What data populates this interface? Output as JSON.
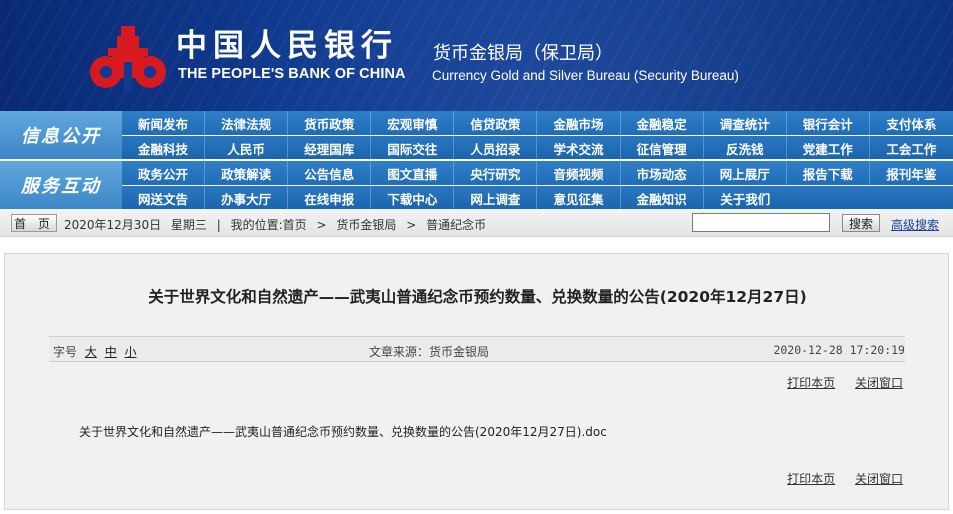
{
  "header": {
    "bank_name_cn": "中国人民银行",
    "bank_name_en": "THE PEOPLE'S BANK OF CHINA",
    "bureau_cn": "货币金银局（保卫局）",
    "bureau_en": "Currency  Gold and Silver Bureau (Security Bureau)",
    "logo": "pboc-logo-icon",
    "colors": {
      "banner": "#0f3a8f",
      "logo_red": "#d71920"
    }
  },
  "nav": {
    "side_top": "信息公开",
    "side_bottom": "服务互动",
    "rows": [
      [
        "新闻发布",
        "法律法规",
        "货币政策",
        "宏观审慎",
        "信贷政策",
        "金融市场",
        "金融稳定",
        "调查统计",
        "银行会计",
        "支付体系"
      ],
      [
        "金融科技",
        "人民币",
        "经理国库",
        "国际交往",
        "人员招录",
        "学术交流",
        "征信管理",
        "反洗钱",
        "党建工作",
        "工会工作"
      ],
      [
        "政务公开",
        "政策解读",
        "公告信息",
        "图文直播",
        "央行研究",
        "音频视频",
        "市场动态",
        "网上展厅",
        "报告下载",
        "报刊年鉴"
      ],
      [
        "网送文告",
        "办事大厅",
        "在线申报",
        "下载中心",
        "网上调查",
        "意见征集",
        "金融知识",
        "关于我们"
      ]
    ],
    "colors": {
      "tab": "#2572bd",
      "side": "#4b95d2"
    }
  },
  "location": {
    "home_label": "首 页",
    "date": "2020年12月30日",
    "weekday": "星期三",
    "separator": "|",
    "position_label": "我的位置:首页",
    "arrow": ">",
    "crumb1": "货币金银局",
    "crumb2": "普通纪念币",
    "search_placeholder": "",
    "search_button": "搜索",
    "advanced_search": "高级搜索"
  },
  "article": {
    "title": "关于世界文化和自然遗产——武夷山普通纪念币预约数量、兑换数量的公告(2020年12月27日)",
    "font_size_label": "字号",
    "font_large": "大",
    "font_medium": "中",
    "font_small": "小",
    "source": "文章来源：货币金银局",
    "datetime": "2020-12-28  17:20:19",
    "print_label": "打印本页",
    "close_label": "关闭窗口",
    "attachment": "关于世界文化和自然遗产——武夷山普通纪念币预约数量、兑换数量的公告(2020年12月27日).doc"
  }
}
